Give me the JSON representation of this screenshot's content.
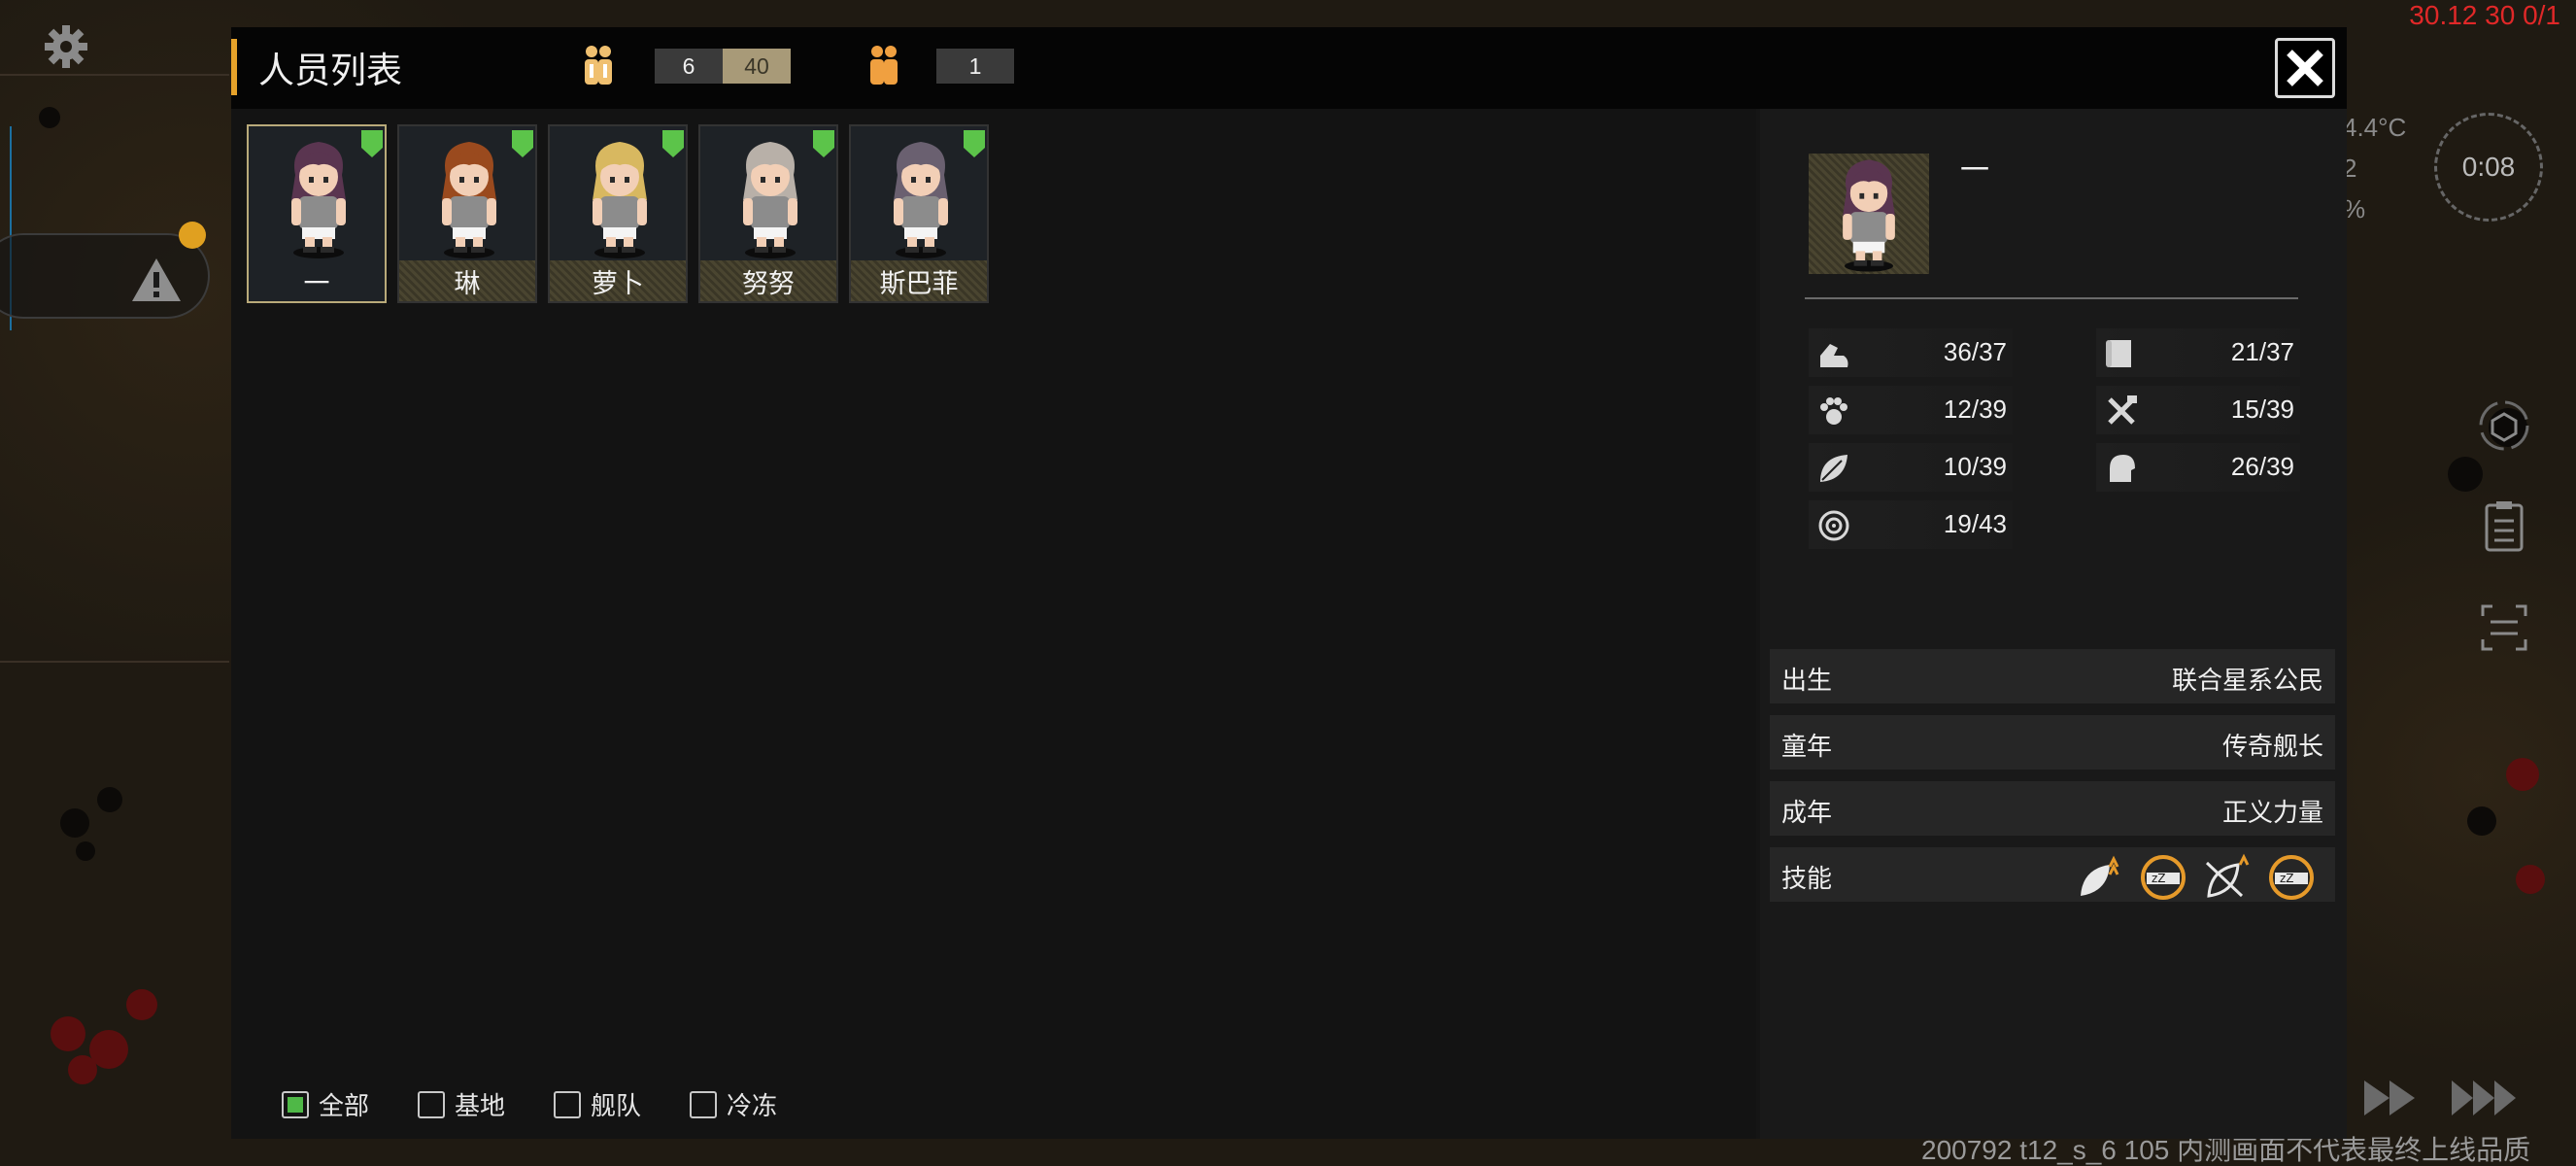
{
  "colors": {
    "accent": "#e6a22a",
    "selected_check": "#4fb847",
    "badge_green": "#5cc44a",
    "warning_red": "#e02828"
  },
  "hud": {
    "top_right_status": "30.12 30 0/1",
    "weather_temp": "4.4°C",
    "weather_line2": "2",
    "weather_line3": "%",
    "clock_time": "0:08",
    "watermark": "200792 t12_s_6 105  内测画面不代表最终上线品质"
  },
  "dialog": {
    "title": "人员列表",
    "population_count": "6",
    "population_capacity": "40",
    "secondary_count": "1",
    "close_icon": "close-x"
  },
  "crew": [
    {
      "name": "一",
      "hair": "#5a3550",
      "selected": true
    },
    {
      "name": "琳",
      "hair": "#9a4a1e",
      "selected": false
    },
    {
      "name": "萝卜",
      "hair": "#d8b860",
      "selected": false
    },
    {
      "name": "努努",
      "hair": "#b8b0a8",
      "selected": false
    },
    {
      "name": "斯巴菲",
      "hair": "#6a6070",
      "selected": false
    }
  ],
  "filters": [
    {
      "label": "全部",
      "checked": true
    },
    {
      "label": "基地",
      "checked": false
    },
    {
      "label": "舰队",
      "checked": false
    },
    {
      "label": "冷冻",
      "checked": false
    }
  ],
  "detail": {
    "name": "一",
    "stats": [
      {
        "icon": "arm-strength-icon",
        "value": "36/37"
      },
      {
        "icon": "scroll-icon",
        "value": "21/37"
      },
      {
        "icon": "paw-icon",
        "value": "12/39"
      },
      {
        "icon": "tools-icon",
        "value": "15/39"
      },
      {
        "icon": "leaf-icon",
        "value": "10/39"
      },
      {
        "icon": "head-icon",
        "value": "26/39"
      },
      {
        "icon": "target-icon",
        "value": "19/43"
      }
    ],
    "background": [
      {
        "key": "出生",
        "value": "联合星系公民"
      },
      {
        "key": "童年",
        "value": "传奇舰长"
      },
      {
        "key": "成年",
        "value": "正义力量"
      }
    ],
    "skills_label": "技能",
    "skills": [
      "leaf-boost-icon",
      "sleep-icon",
      "leaf-slash-icon",
      "sleep-icon"
    ]
  }
}
